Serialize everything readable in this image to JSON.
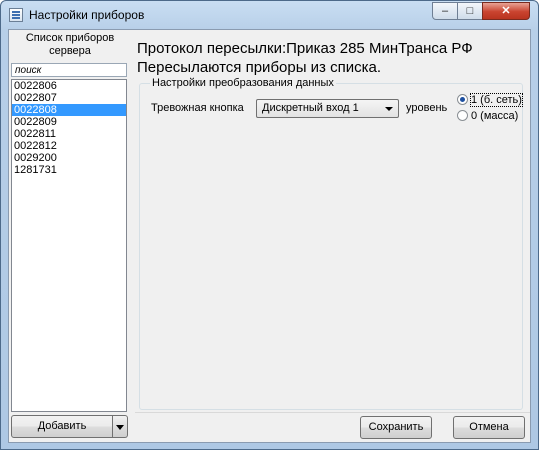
{
  "window": {
    "title": "Настройки приборов",
    "min": "–",
    "max": "□",
    "close": "✕"
  },
  "sidebar": {
    "title_line1": "Список приборов",
    "title_line2": "сервера",
    "search_placeholder": "поиск",
    "items": [
      "0022806",
      "0022807",
      "0022808",
      "0022809",
      "0022811",
      "0022812",
      "0029200",
      "1281731"
    ],
    "selected": "0022808",
    "add_label": "Добавить"
  },
  "main": {
    "protocol_line": "Протокол пересылки:Приказ 285 МинТранса РФ",
    "send_line": "Пересылаются приборы из списка.",
    "group_title": "Настройки преобразования данных",
    "alarm_label": "Тревожная кнопка",
    "alarm_value": "Дискретный вход 1",
    "level_label": "уровень",
    "radio1": "1 (б. сеть)",
    "radio2": "0 (масса)",
    "radio_selected": 1
  },
  "buttons": {
    "save": "Сохранить",
    "cancel": "Отмена"
  }
}
